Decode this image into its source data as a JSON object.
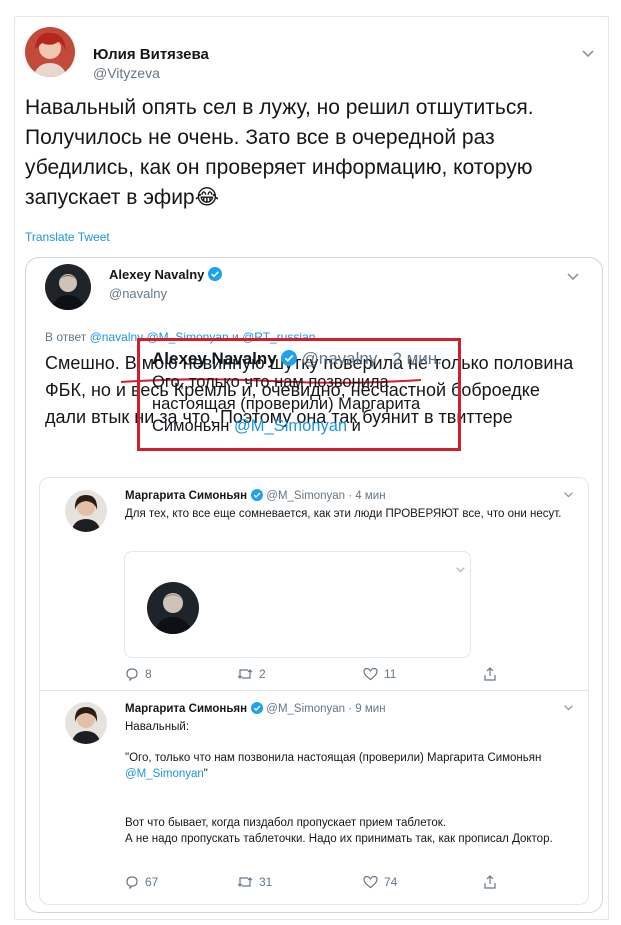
{
  "tweet": {
    "author_name": "Юлия Витязева",
    "author_handle": "@Vityzeva",
    "text": "Навальный опять сел в лужу, но решил отшутиться. Получилось не очень. Зато все в очередной раз убедились, как он проверяет информацию, которую запускает в эфир😂",
    "translate_label": "Translate Tweet"
  },
  "quoted": {
    "author_name": "Alexey Navalny",
    "author_handle": "@navalny",
    "replying_prefix": "В ответ",
    "replying_mention_1": "@navalny @M_Simonyan",
    "replying_and": "и",
    "replying_mention_2": "@RT_russian",
    "text": "Смешно. В мою невинную шутку поверила не только половина ФБК, но и весь Кремль и, очевидно, несчастной боброедке дали втык ни за что. Поэтому она так буянит в твиттере"
  },
  "thread": [
    {
      "author_name": "Маргарита Симоньян",
      "meta": "@M_Simonyan · 4 мин",
      "text": "Для тех, кто все еще сомневается, как эти люди ПРОВЕРЯЮТ все, что они несут.",
      "embedded": {
        "author_name": "Alexey Navalny",
        "meta": "@navalny · 2 мин.",
        "text": "Ого, только что нам позвонила настоящая (проверили) Маргарита Симоньян",
        "mention": "@M_Simonyan",
        "tail": "и"
      },
      "replies": "8",
      "retweets": "2",
      "likes": "11"
    },
    {
      "author_name": "Маргарита Симоньян",
      "meta": "@M_Simonyan · 9 мин",
      "text_1": "Навальный:",
      "text_2": "\"Ого, только что нам позвонила настоящая (проверили) Маргарита Симоньян",
      "mention": "@M_Simonyan",
      "quote_close": "\"",
      "text_3": "Вот что бывает, когда пиздабол пропускает прием таблеток.",
      "text_4": "А не надо пропускать таблеточки. Надо их принимать так, как прописал Доктор.",
      "replies": "67",
      "retweets": "31",
      "likes": "74"
    }
  ],
  "colors": {
    "link": "#1b95e0",
    "muted": "#657786",
    "border": "#e1e8ed",
    "highlight_box": "#d31e2e",
    "underline": "#d31e2e"
  },
  "icons": [
    "chevron-down-icon",
    "verified-badge-icon",
    "reply-icon",
    "retweet-icon",
    "like-icon",
    "share-icon"
  ]
}
